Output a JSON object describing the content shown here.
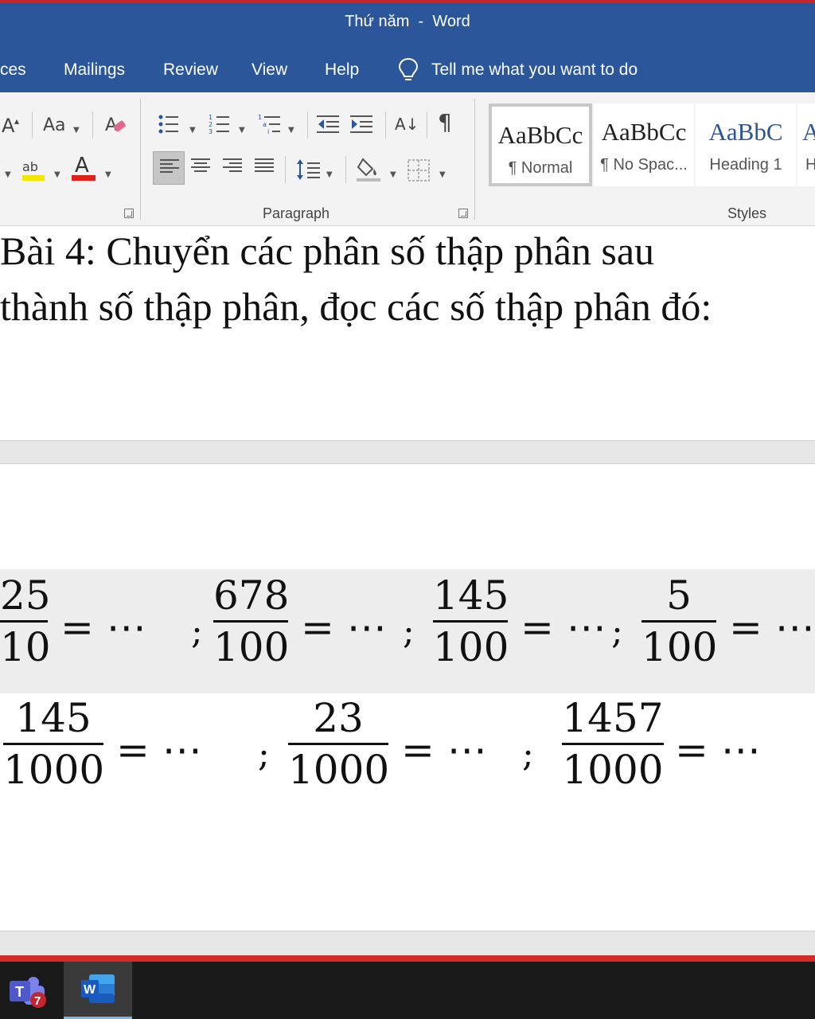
{
  "window": {
    "doc_name": "Thứ năm",
    "separator": "-",
    "app_name": "Word"
  },
  "tabs": [
    "ces",
    "Mailings",
    "Review",
    "View",
    "Help"
  ],
  "tell_me": "Tell me what you want to do",
  "ribbon": {
    "font_size_glyph": "A",
    "change_case": "Aa",
    "highlight_glyph": "ab",
    "font_color_glyph": "A",
    "sort_glyph": "A↓",
    "pilcrow": "¶",
    "paragraph_label": "Paragraph",
    "styles_label": "Styles",
    "styles": [
      {
        "preview": "AaBbCc",
        "name": "¶ Normal",
        "color": "#222222"
      },
      {
        "preview": "AaBbCc",
        "name": "¶ No Spac...",
        "color": "#222222"
      },
      {
        "preview": "AaBbC",
        "name": "Heading 1",
        "color": "#2f5496"
      },
      {
        "preview": "A",
        "name": "H",
        "color": "#2f5496"
      }
    ]
  },
  "document": {
    "line1": "Bài 4: Chuyển các phân số thập phân sau",
    "line2": "thành số thập phân, đọc các số thập phân đó:",
    "row1": [
      {
        "num": "25",
        "den": "10"
      },
      {
        "num": "678",
        "den": "100"
      },
      {
        "num": "145",
        "den": "100"
      },
      {
        "num": "5",
        "den": "100"
      }
    ],
    "row2": [
      {
        "num": "145",
        "den": "1000"
      },
      {
        "num": "23",
        "den": "1000"
      },
      {
        "num": "1457",
        "den": "1000"
      }
    ],
    "equals_dots": "= ⋯",
    "semicolon": ";"
  },
  "taskbar": {
    "teams_badge": "7",
    "teams_letter": "T",
    "word_letter": "W"
  },
  "colors": {
    "title_bar": "#2b579a",
    "top_accent": "#c4262e",
    "font_color_bar": "#e0201c",
    "highlight_bar": "#f2e600",
    "teams": "#5059c9",
    "word": "#185abd"
  }
}
